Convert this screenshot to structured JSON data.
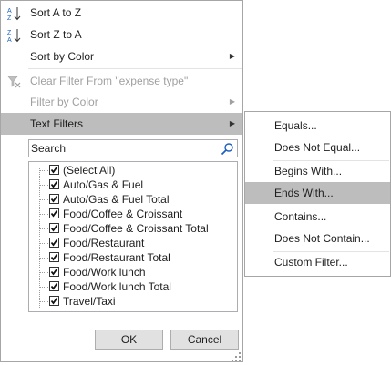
{
  "menu": {
    "sort_az": "Sort A to Z",
    "sort_za": "Sort Z to A",
    "sort_by_color": "Sort by Color",
    "clear_filter": "Clear Filter From \"expense type\"",
    "filter_by_color": "Filter by Color",
    "text_filters": "Text Filters"
  },
  "search": {
    "placeholder": "Search"
  },
  "list": {
    "items": [
      {
        "label": "(Select All)",
        "checked": true
      },
      {
        "label": "Auto/Gas & Fuel",
        "checked": true
      },
      {
        "label": "Auto/Gas & Fuel Total",
        "checked": true
      },
      {
        "label": "Food/Coffee & Croissant",
        "checked": true
      },
      {
        "label": "Food/Coffee & Croissant Total",
        "checked": true
      },
      {
        "label": "Food/Restaurant",
        "checked": true
      },
      {
        "label": "Food/Restaurant Total",
        "checked": true
      },
      {
        "label": "Food/Work lunch",
        "checked": true
      },
      {
        "label": "Food/Work lunch Total",
        "checked": true
      },
      {
        "label": "Travel/Taxi",
        "checked": true
      }
    ]
  },
  "buttons": {
    "ok": "OK",
    "cancel": "Cancel"
  },
  "submenu": {
    "equals": "Equals...",
    "does_not_equal": "Does Not Equal...",
    "begins_with": "Begins With...",
    "ends_with": "Ends With...",
    "contains": "Contains...",
    "does_not_contain": "Does Not Contain...",
    "custom_filter": "Custom Filter..."
  },
  "colors": {
    "highlight": "#bdbdbd",
    "sort_icon_blue": "#1f5fbf",
    "disabled_text": "#a0a0a0"
  },
  "icons": [
    "sort-az-icon",
    "sort-za-icon",
    "clear-filter-icon",
    "search-icon",
    "submenu-arrow-icon",
    "checkbox-check-icon",
    "resize-grip-icon"
  ]
}
